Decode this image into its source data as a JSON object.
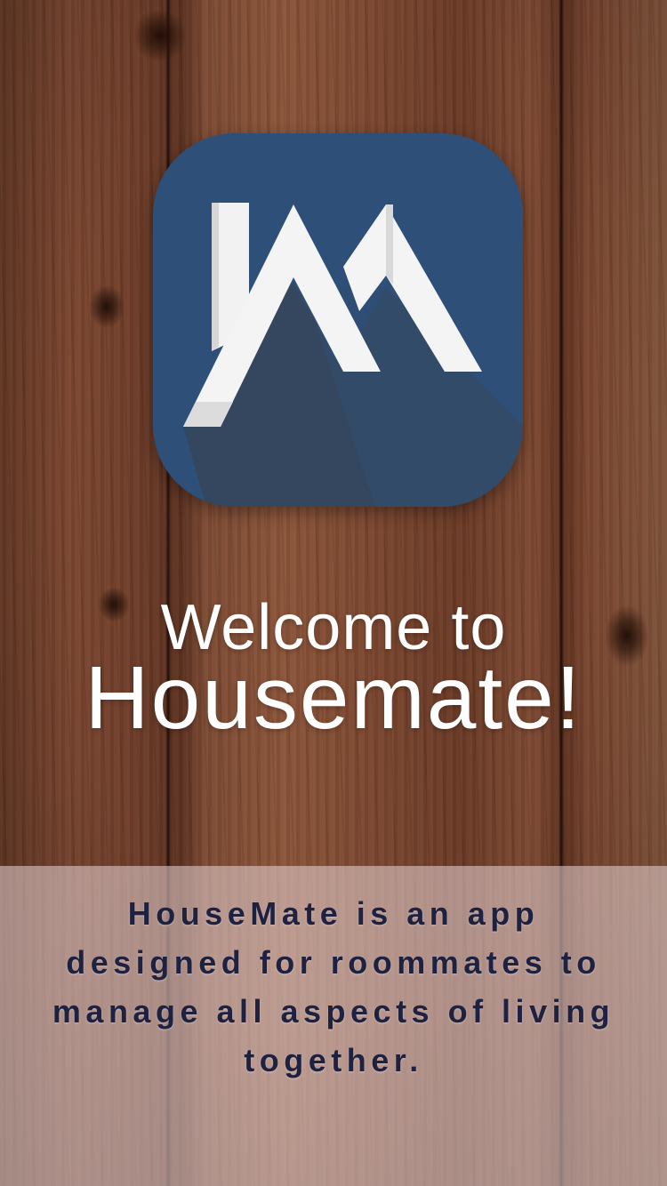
{
  "welcome": {
    "line1": "Welcome to",
    "line2": "Housemate!"
  },
  "app_icon": {
    "name": "housemate-logo-icon",
    "background_color": "#2e4f78"
  },
  "description": {
    "text": "HouseMate is an app\ndesigned  for roommates to\nmanage all aspects of living\ntogether."
  },
  "colors": {
    "title_text": "#ffffff",
    "description_text": "#1f2140",
    "panel_overlay": "rgba(225,205,205,0.58)"
  }
}
